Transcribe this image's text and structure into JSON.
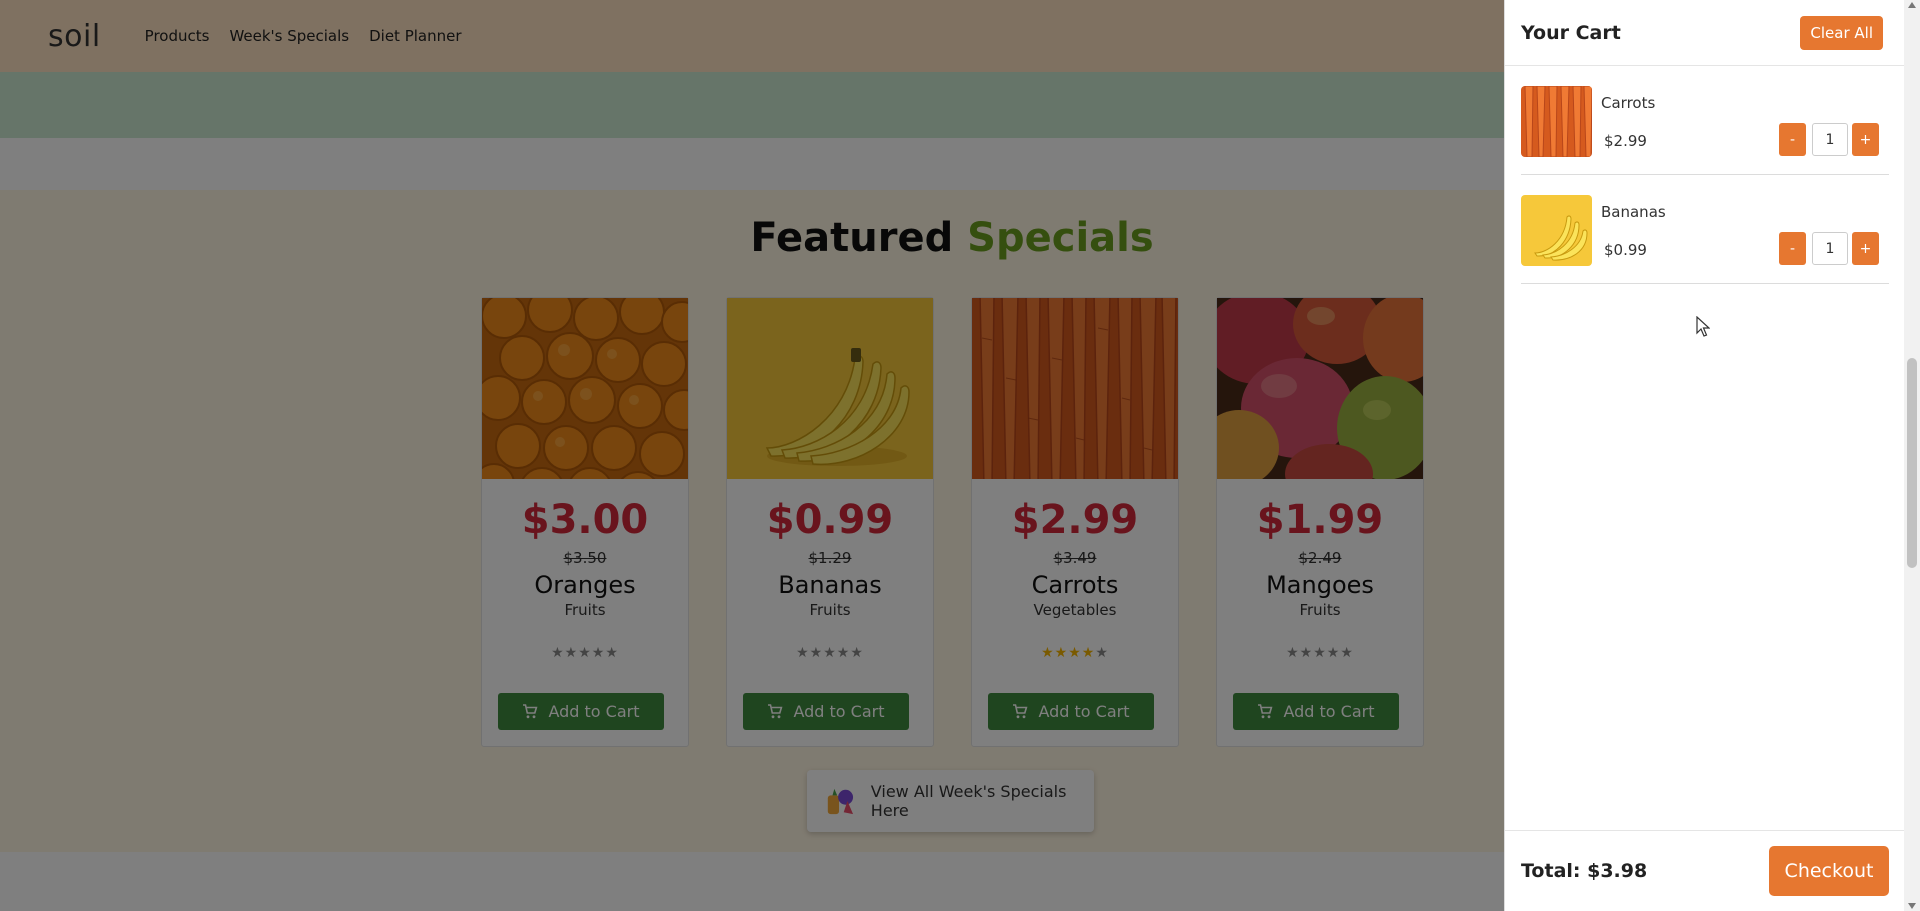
{
  "navbar": {
    "logo": "soil",
    "links": [
      "Products",
      "Week's Specials",
      "Diet Planner"
    ]
  },
  "featured": {
    "title_main": "Featured",
    "title_accent": "Specials",
    "add_to_cart_label": "Add to Cart",
    "products": [
      {
        "name": "Oranges",
        "category": "Fruits",
        "price": "$3.00",
        "old_price": "$3.50",
        "rating": 0,
        "max_rating": 5
      },
      {
        "name": "Bananas",
        "category": "Fruits",
        "price": "$0.99",
        "old_price": "$1.29",
        "rating": 0,
        "max_rating": 5
      },
      {
        "name": "Carrots",
        "category": "Vegetables",
        "price": "$2.99",
        "old_price": "$3.49",
        "rating": 4,
        "max_rating": 5
      },
      {
        "name": "Mangoes",
        "category": "Fruits",
        "price": "$1.99",
        "old_price": "$2.49",
        "rating": 0,
        "max_rating": 5
      }
    ],
    "view_all_label": "View All Week's Specials Here"
  },
  "cart": {
    "title": "Your Cart",
    "clear_label": "Clear All",
    "items": [
      {
        "name": "Carrots",
        "price": "$2.99",
        "qty": "1",
        "minus": "-",
        "plus": "+"
      },
      {
        "name": "Bananas",
        "price": "$0.99",
        "qty": "1",
        "minus": "-",
        "plus": "+"
      }
    ],
    "total_label": "Total: $3.98",
    "checkout_label": "Checkout"
  },
  "colors": {
    "navbar_bg": "#ffe3c2",
    "accent_green": "#6a9e1f",
    "price_red": "#d2283a",
    "button_green": "#3f8a3f",
    "cart_orange": "#e67730",
    "star_gold": "#f5b400"
  }
}
